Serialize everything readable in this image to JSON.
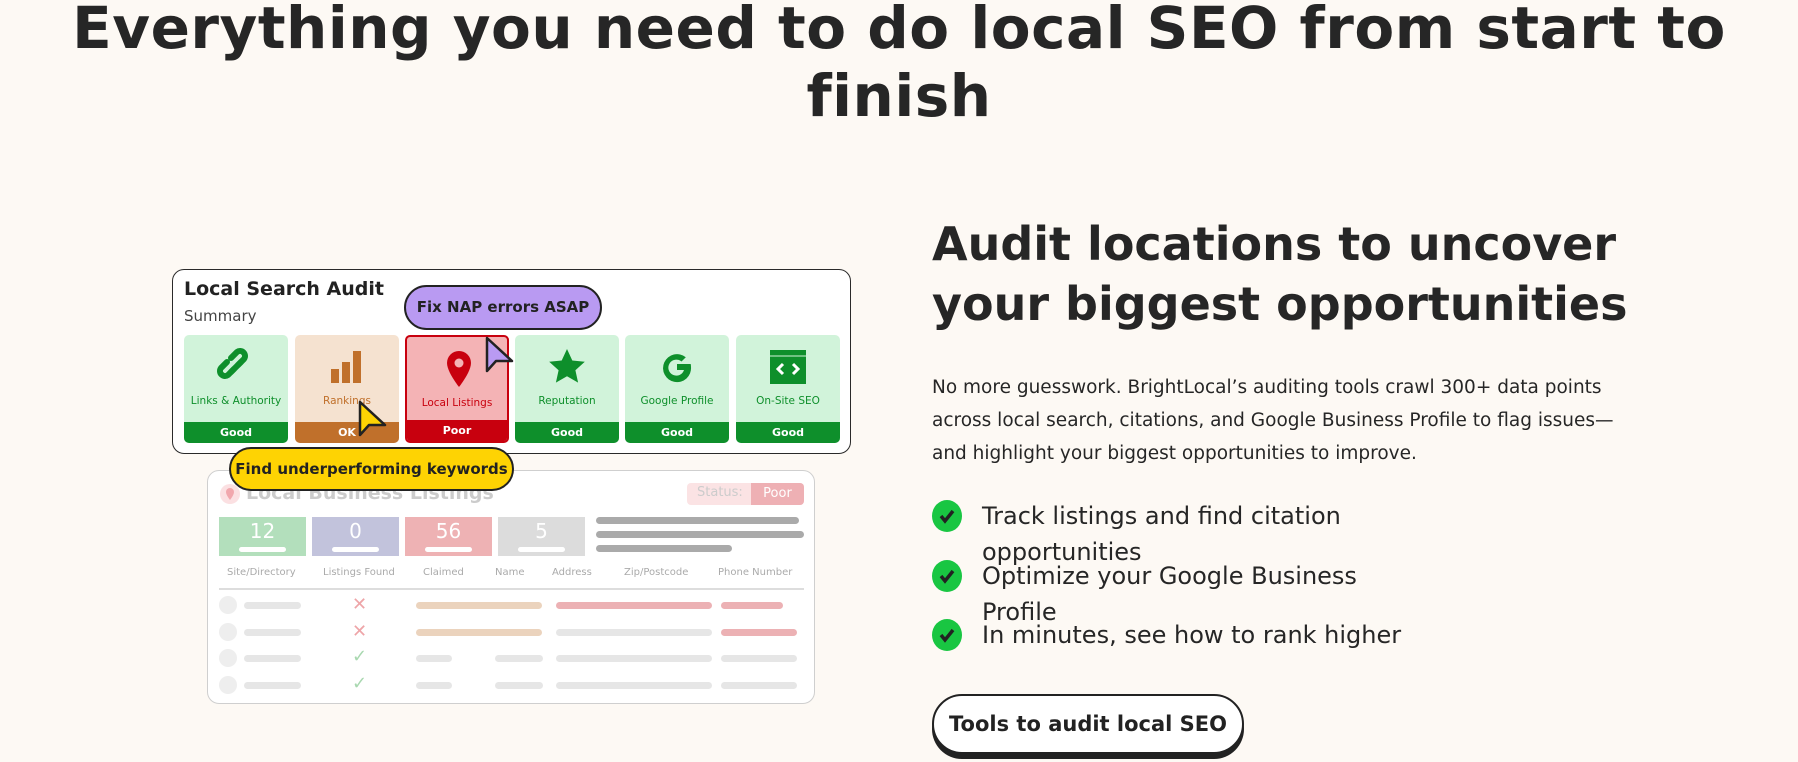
{
  "page": {
    "title": "Everything you need to do local SEO from start to finish"
  },
  "audit_card": {
    "title": "Local Search Audit",
    "subtitle": "Summary",
    "tiles": [
      {
        "label": "Links & Authority",
        "status": "Good",
        "icon": "link-icon"
      },
      {
        "label": "Rankings",
        "status": "OK",
        "icon": "bar-chart-icon"
      },
      {
        "label": "Local Listings",
        "status": "Poor",
        "icon": "map-pin-icon"
      },
      {
        "label": "Reputation",
        "status": "Good",
        "icon": "star-icon"
      },
      {
        "label": "Google Profile",
        "status": "Good",
        "icon": "google-icon"
      },
      {
        "label": "On-Site SEO",
        "status": "Good",
        "icon": "code-window-icon"
      }
    ],
    "callout_nap": "Fix NAP errors ASAP",
    "callout_keywords": "Find underperforming keywords"
  },
  "listings_panel": {
    "title": "Local Business Listings",
    "status_label": "Status:",
    "status_value": "Poor",
    "stats": [
      "12",
      "0",
      "56",
      "5"
    ],
    "columns": [
      "Site/Directory",
      "Listings Found",
      "Claimed",
      "Name",
      "Address",
      "Zip/Postcode",
      "Phone Number"
    ]
  },
  "feature": {
    "heading": "Audit locations to uncover your biggest opportunities",
    "description": "No more guesswork. BrightLocal’s auditing tools crawl 300+ data points across local search, citations, and Google Business Profile to flag issues—and highlight your biggest opportunities to improve.",
    "checklist": [
      "Track listings and find citation opportunities",
      "Optimize your Google Business Profile",
      "In minutes, see how to rank higher"
    ],
    "cta": "Tools to audit local SEO"
  },
  "colors": {
    "good": "#0e8f2b",
    "ok": "#c0702b",
    "poor": "#c8000e",
    "check": "#19c642",
    "background": "#fdf9f4"
  }
}
